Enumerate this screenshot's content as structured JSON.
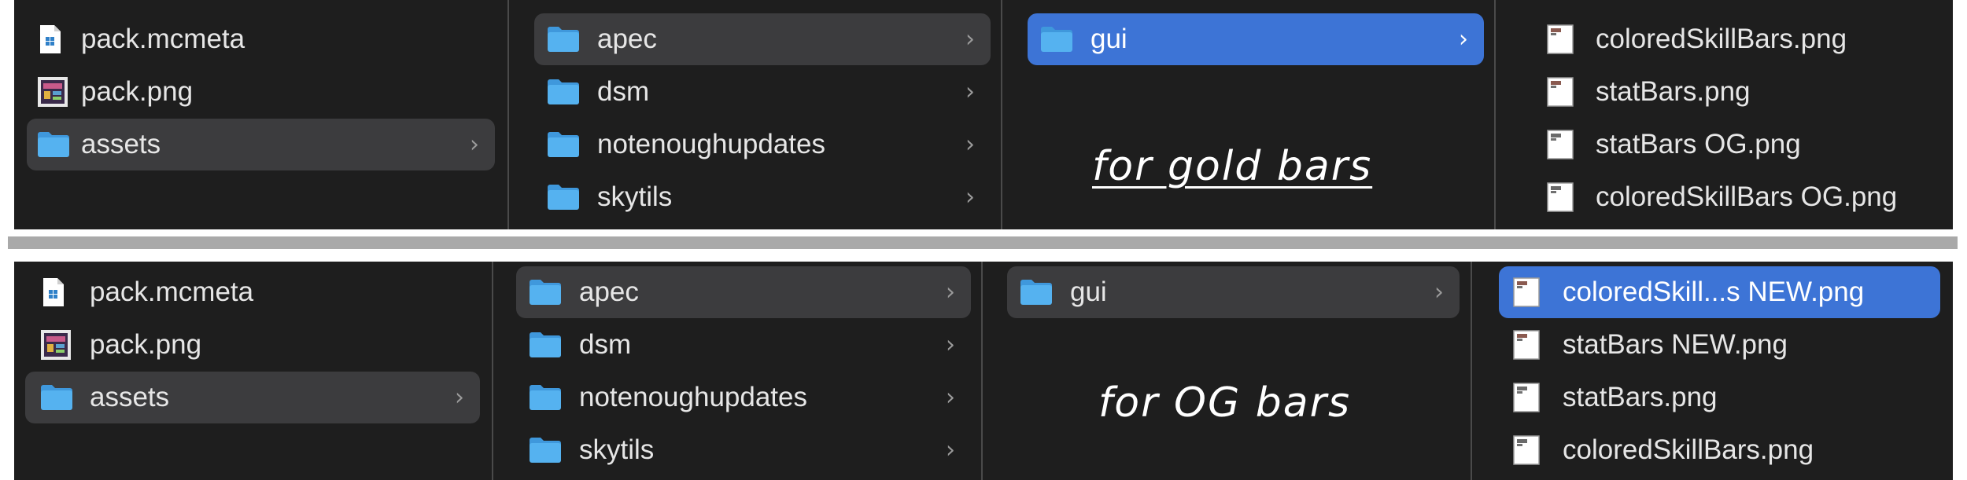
{
  "panels": [
    {
      "columns": [
        {
          "items": [
            {
              "label": "pack.mcmeta",
              "icon": "mcmeta-file-icon"
            },
            {
              "label": "pack.png",
              "icon": "png-image-file-icon"
            },
            {
              "label": "assets",
              "icon": "folder-icon",
              "state": "selected-inactive",
              "has_chevron": true
            }
          ]
        },
        {
          "items": [
            {
              "label": "apec",
              "icon": "folder-icon",
              "state": "selected-inactive",
              "has_chevron": true
            },
            {
              "label": "dsm",
              "icon": "folder-icon",
              "has_chevron": true
            },
            {
              "label": "notenoughupdates",
              "icon": "folder-icon",
              "has_chevron": true
            },
            {
              "label": "skytils",
              "icon": "folder-icon",
              "has_chevron": true
            }
          ]
        },
        {
          "items": [
            {
              "label": "gui",
              "icon": "folder-icon",
              "state": "selected-active",
              "has_chevron": true
            }
          ],
          "note": "for gold bars",
          "note_underline": true
        },
        {
          "items": [
            {
              "label": "coloredSkillBars.png",
              "icon": "png-file-icon"
            },
            {
              "label": "statBars.png",
              "icon": "png-file-icon"
            },
            {
              "label": "statBars OG.png",
              "icon": "png-file-icon"
            },
            {
              "label": "coloredSkillBars OG.png",
              "icon": "png-file-icon"
            }
          ]
        }
      ]
    },
    {
      "columns": [
        {
          "items": [
            {
              "label": "pack.mcmeta",
              "icon": "mcmeta-file-icon"
            },
            {
              "label": "pack.png",
              "icon": "png-image-file-icon"
            },
            {
              "label": "assets",
              "icon": "folder-icon",
              "state": "selected-inactive",
              "has_chevron": true
            }
          ]
        },
        {
          "items": [
            {
              "label": "apec",
              "icon": "folder-icon",
              "state": "selected-inactive",
              "has_chevron": true
            },
            {
              "label": "dsm",
              "icon": "folder-icon",
              "has_chevron": true
            },
            {
              "label": "notenoughupdates",
              "icon": "folder-icon",
              "has_chevron": true
            },
            {
              "label": "skytils",
              "icon": "folder-icon",
              "has_chevron": true
            }
          ]
        },
        {
          "items": [
            {
              "label": "gui",
              "icon": "folder-icon",
              "state": "selected-inactive",
              "has_chevron": true
            }
          ],
          "note": "for OG bars",
          "note_underline": false
        },
        {
          "items": [
            {
              "label": "coloredSkill...s NEW.png",
              "icon": "png-file-icon",
              "state": "selected-active"
            },
            {
              "label": "statBars NEW.png",
              "icon": "png-file-icon"
            },
            {
              "label": "statBars.png",
              "icon": "png-file-icon"
            },
            {
              "label": "coloredSkillBars.png",
              "icon": "png-file-icon"
            }
          ]
        }
      ]
    }
  ],
  "chevron_glyph": "›",
  "colors": {
    "panel_bg": "#1e1e1e",
    "selection_active": "#3d74d6",
    "selection_inactive": "#3c3c3e",
    "folder": "#55b2f0",
    "divider": "#a9a9a9"
  }
}
